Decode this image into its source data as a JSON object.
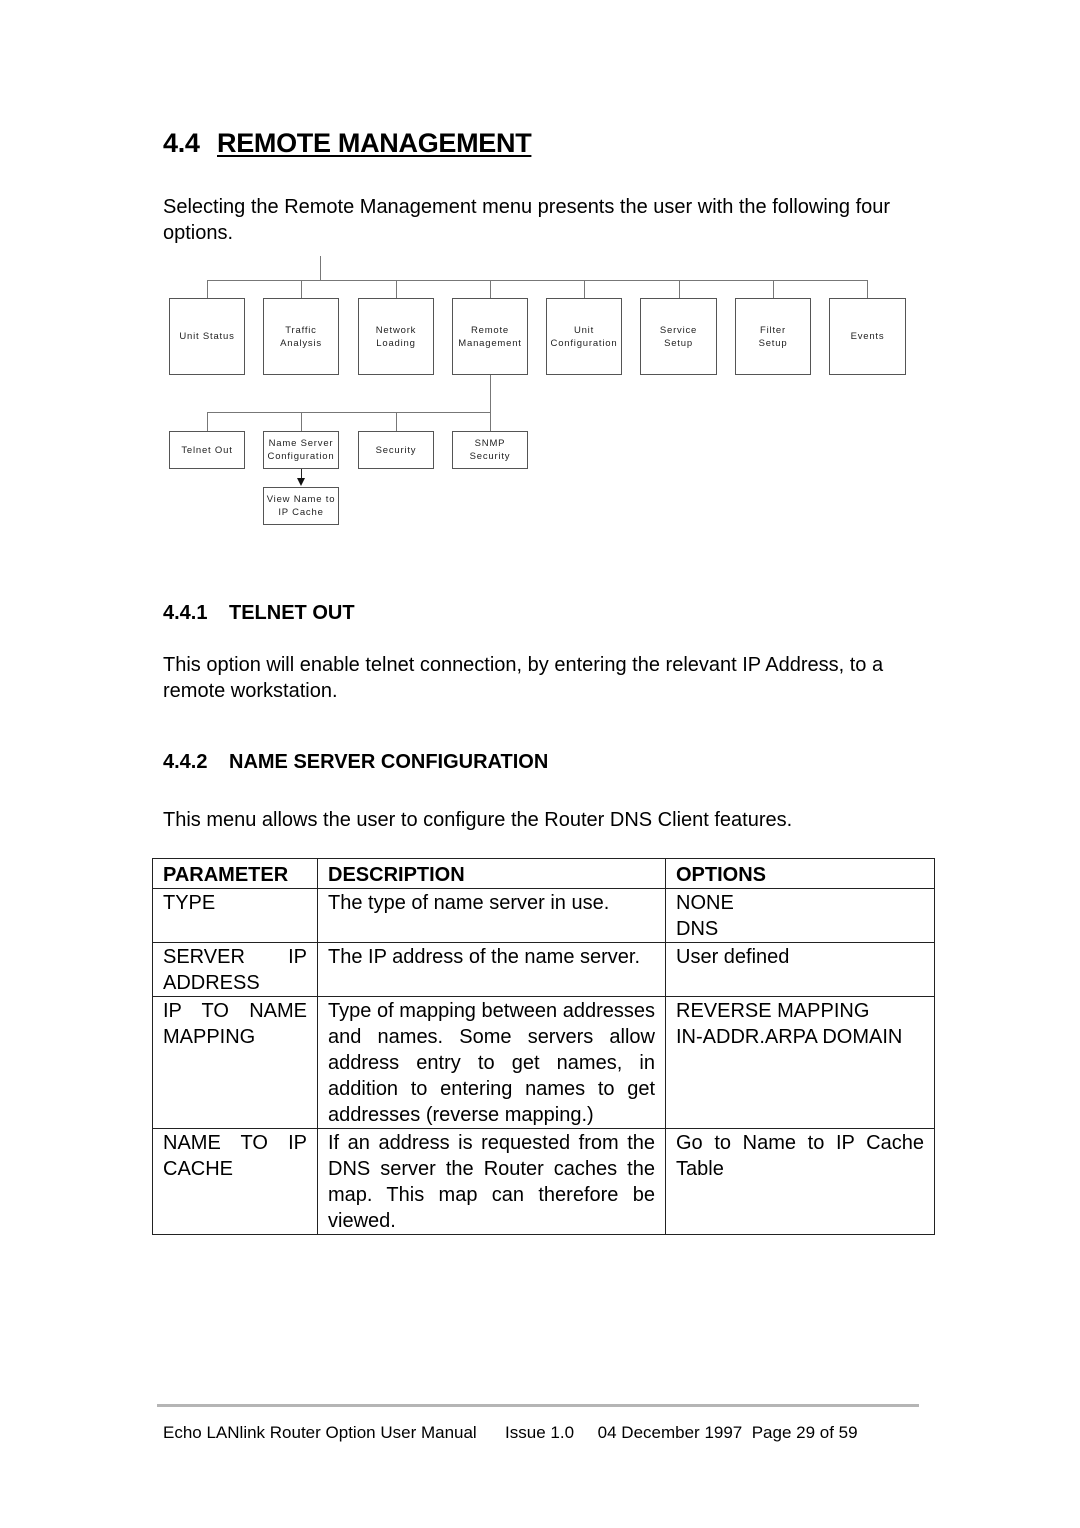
{
  "section": {
    "number": "4.4",
    "title": "REMOTE MANAGEMENT",
    "intro": "Selecting the Remote Management menu presents the user with the following four options."
  },
  "diagram": {
    "top_level": [
      "Unit Status",
      "Traffic\nAnalysis",
      "Network\nLoading",
      "Remote\nManagement",
      "Unit\nConfiguration",
      "Service\nSetup",
      "Filter\nSetup",
      "Events"
    ],
    "sub_level": [
      "Telnet Out",
      "Name Server\nConfiguration",
      "Security",
      "SNMP\nSecurity"
    ],
    "third_level": "View Name to\nIP Cache"
  },
  "telnet": {
    "number": "4.4.1",
    "title": "TELNET OUT",
    "text": "This option will enable telnet connection, by entering the relevant IP Address, to a remote workstation."
  },
  "name_server": {
    "number": "4.4.2",
    "title": "NAME SERVER CONFIGURATION",
    "text": "This menu allows the user to configure the Router DNS Client features."
  },
  "table": {
    "headers": [
      "PARAMETER",
      "DESCRIPTION",
      "OPTIONS"
    ],
    "rows": [
      {
        "parameter": "TYPE",
        "description": "The type of name server in use.",
        "options": [
          "NONE",
          "DNS"
        ]
      },
      {
        "parameter": "SERVER IP ADDRESS",
        "description": "The IP address of the name server.",
        "options": [
          "User defined"
        ]
      },
      {
        "parameter": "IP TO NAME MAPPING",
        "description": "Type of mapping between addresses and names.  Some servers allow address entry to get names, in addition to entering names to get addresses (reverse mapping.)",
        "options": [
          "REVERSE MAPPING",
          "IN-ADDR.ARPA DOMAIN"
        ]
      },
      {
        "parameter": "NAME TO IP CACHE",
        "description": "If an address is requested from the DNS server the Router caches the map.  This map can therefore be viewed.",
        "options": [
          "Go to Name to IP Cache Table"
        ]
      }
    ]
  },
  "footer": {
    "manual": "Echo LANlink Router Option User Manual",
    "issue": "Issue 1.0",
    "date_page": "04 December 1997  Page 29 of 59"
  }
}
